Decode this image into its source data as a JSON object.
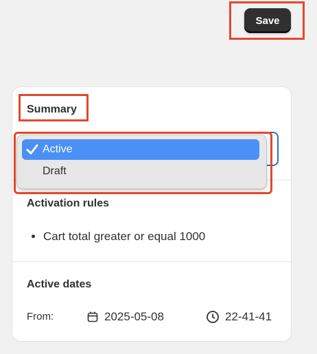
{
  "header": {
    "save_label": "Save"
  },
  "summary": {
    "title": "Summary",
    "status_select": {
      "options": [
        {
          "label": "Active",
          "selected": true
        },
        {
          "label": "Draft",
          "selected": false
        }
      ]
    },
    "activation_rules": {
      "title": "Activation rules",
      "rules": [
        "Cart total greater or equal 1000"
      ]
    },
    "active_dates": {
      "title": "Active dates",
      "from_label": "From:",
      "date": "2025-05-08",
      "time": "22-41-41",
      "date_icon": "calendar-icon",
      "time_icon": "clock-icon"
    }
  },
  "colors": {
    "annotation": "#e4472c",
    "accent": "#4a90f5",
    "save_button": "#303030"
  }
}
